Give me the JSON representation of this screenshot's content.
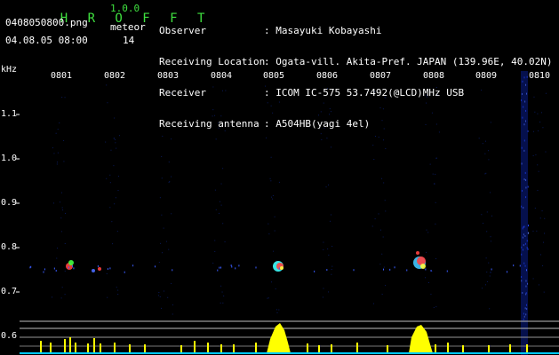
{
  "header": {
    "app_name": "H R O F F T",
    "app_version": "1.0.0",
    "file_name": "0408050800.png",
    "datetime": "04.08.05 08:00",
    "meteor_label": "meteor",
    "meteor_count": "14"
  },
  "info": [
    {
      "label": "Observer",
      "value": ": Masayuki Kobayashi"
    },
    {
      "label": "Receiving Location",
      "value": ": Ogata-vill. Akita-Pref. JAPAN (139.96E, 40.02N)"
    },
    {
      "label": "Receiver",
      "value": ": ICOM IC-575 53.7492(@LCD)MHz USB"
    },
    {
      "label": "Receiving antenna",
      "value": ": A504HB(yagi 4el)"
    }
  ],
  "spectrogram": {
    "y_unit": "kHz",
    "y_ticks": [
      "1.1",
      "1.0",
      "0.9",
      "0.8",
      "0.7",
      "0.6"
    ],
    "x_ticks": [
      "0801",
      "0802",
      "0803",
      "0804",
      "0805",
      "0806",
      "0807",
      "0808",
      "0809",
      "0810"
    ]
  },
  "colors": {
    "background": "#000000",
    "title_green": "#3fe03f",
    "histogram": "#ffff00",
    "baseline": "#00c8ff"
  }
}
